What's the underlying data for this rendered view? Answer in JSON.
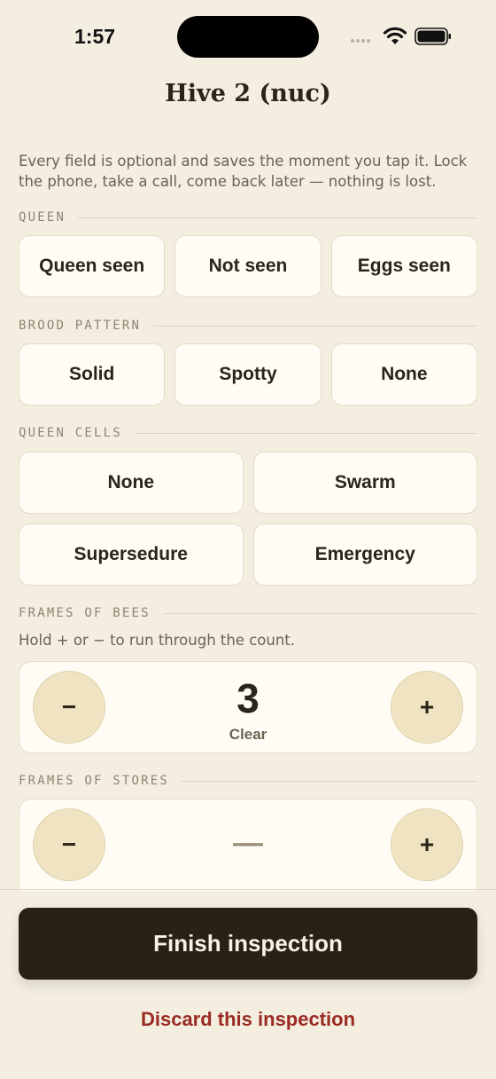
{
  "status_bar": {
    "time": "1:57"
  },
  "header": {
    "title": "Hive 2 (nuc)"
  },
  "intro": "Every field is optional and saves the moment you tap it. Lock the phone, take a call, come back later — nothing is lost.",
  "queen": {
    "label": "QUEEN",
    "options": [
      "Queen seen",
      "Not seen",
      "Eggs seen"
    ]
  },
  "brood_pattern": {
    "label": "BROOD PATTERN",
    "options": [
      "Solid",
      "Spotty",
      "None"
    ]
  },
  "queen_cells": {
    "label": "QUEEN CELLS",
    "options": [
      "None",
      "Swarm",
      "Supersedure",
      "Emergency"
    ]
  },
  "frames_of_bees": {
    "label": "FRAMES OF BEES",
    "hint": "Hold + or − to run through the count.",
    "value": "3",
    "clear_label": "Clear",
    "minus": "−",
    "plus": "+"
  },
  "frames_of_stores": {
    "label": "FRAMES OF STORES",
    "value": "—",
    "minus": "−",
    "plus": "+"
  },
  "actions": {
    "finish_label": "Finish inspection",
    "discard_label": "Discard this inspection"
  },
  "colors": {
    "background": "#f3eee0",
    "primary_button": "#2a2116",
    "danger_text": "#9a2b22",
    "stepper_button": "#efe3c2"
  }
}
